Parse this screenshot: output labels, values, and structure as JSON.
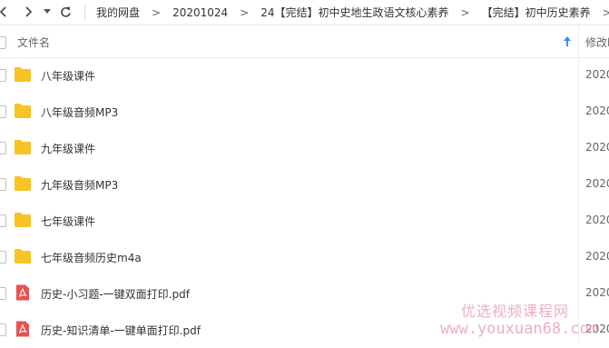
{
  "nav": {
    "back_icon": "chevron-left-icon",
    "forward_icon": "chevron-right-icon",
    "history_icon": "caret-down-icon",
    "refresh_icon": "refresh-icon"
  },
  "breadcrumbs": [
    {
      "label": "我的网盘"
    },
    {
      "label": "20201024"
    },
    {
      "label": "24【完结】初中史地生政语文核心素养"
    },
    {
      "label": "【完结】初中历史素养"
    }
  ],
  "breadcrumb_separator": ">",
  "columns": {
    "name": "文件名",
    "date": "修改时"
  },
  "files": [
    {
      "name": "八年级课件",
      "type": "folder",
      "date": "2020"
    },
    {
      "name": "八年级音频MP3",
      "type": "folder",
      "date": "2020"
    },
    {
      "name": "九年级课件",
      "type": "folder",
      "date": "2020"
    },
    {
      "name": "九年级音频MP3",
      "type": "folder",
      "date": "2020"
    },
    {
      "name": "七年级课件",
      "type": "folder",
      "date": "2020"
    },
    {
      "name": "七年级音频历史m4a",
      "type": "folder",
      "date": "2020"
    },
    {
      "name": "历史-小习题-一键双面打印.pdf",
      "type": "pdf",
      "date": "2020"
    },
    {
      "name": "历史-知识清单-一键单面打印.pdf",
      "type": "pdf",
      "date": "2020"
    }
  ],
  "colors": {
    "folder": "#f7c325",
    "pdf": "#e9514f",
    "sort_arrow": "#3b8cf0",
    "watermark": "#e8a0b4"
  },
  "watermark": {
    "line1": "优选视频课程网",
    "line2": "www.youxuan68.com"
  }
}
